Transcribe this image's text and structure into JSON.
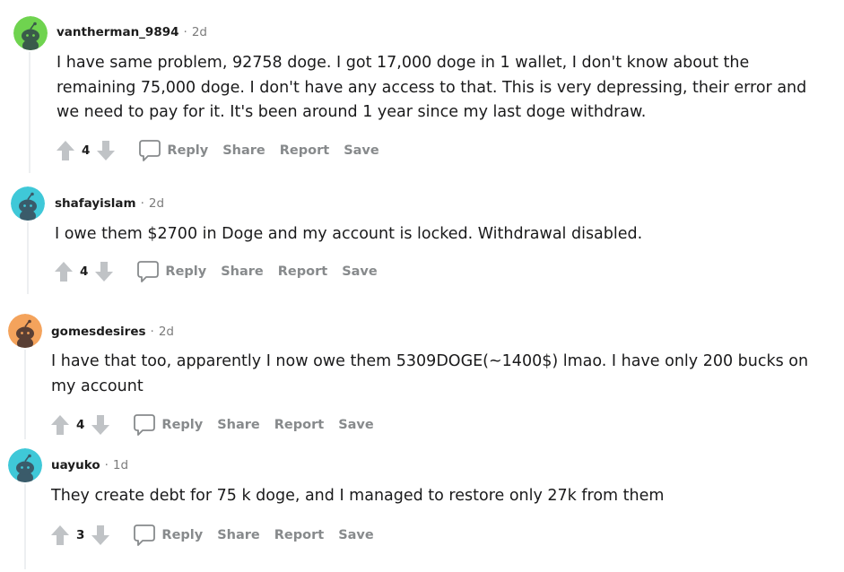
{
  "comments": [
    {
      "username": "vantherman_9894",
      "separator": "·",
      "time": "2d",
      "avatar_color": "#6fd34f",
      "body": "I have same problem, 92758 doge. I got 17,000 doge in 1 wallet, I don't know about the remaining 75,000 doge. I don't have any access to that. This is very depressing, their error and we need to pay for it. It's been around 1 year since my last doge withdraw.",
      "score": "4",
      "reply": "Reply",
      "share": "Share",
      "report": "Report",
      "save": "Save"
    },
    {
      "username": "shafayislam",
      "separator": "·",
      "time": "2d",
      "avatar_color": "#3fc8d8",
      "body": "I owe them $2700 in Doge and my account is locked. Withdrawal disabled.",
      "score": "4",
      "reply": "Reply",
      "share": "Share",
      "report": "Report",
      "save": "Save"
    },
    {
      "username": "gomesdesires",
      "separator": "·",
      "time": "2d",
      "avatar_color": "#f4a35c",
      "body": "I have that too, apparently I now owe them 5309DOGE(~1400$) lmao. I have only 200 bucks on my account",
      "score": "4",
      "reply": "Reply",
      "share": "Share",
      "report": "Report",
      "save": "Save"
    },
    {
      "username": "uayuko",
      "separator": "·",
      "time": "1d",
      "avatar_color": "#3fc8d8",
      "body": "They create debt for 75 k doge, and I managed to restore only 27k from them",
      "score": "3",
      "reply": "Reply",
      "share": "Share",
      "report": "Report",
      "save": "Save"
    }
  ],
  "icons": {
    "upvote": "arrow-up-icon",
    "downvote": "arrow-down-icon",
    "reply": "speech-bubble-icon",
    "avatar": "snoo-avatar-icon"
  },
  "colors": {
    "vote_icon": "#c0c3c6",
    "action_text": "#878a8c",
    "meta_text": "#7c7c7c"
  }
}
